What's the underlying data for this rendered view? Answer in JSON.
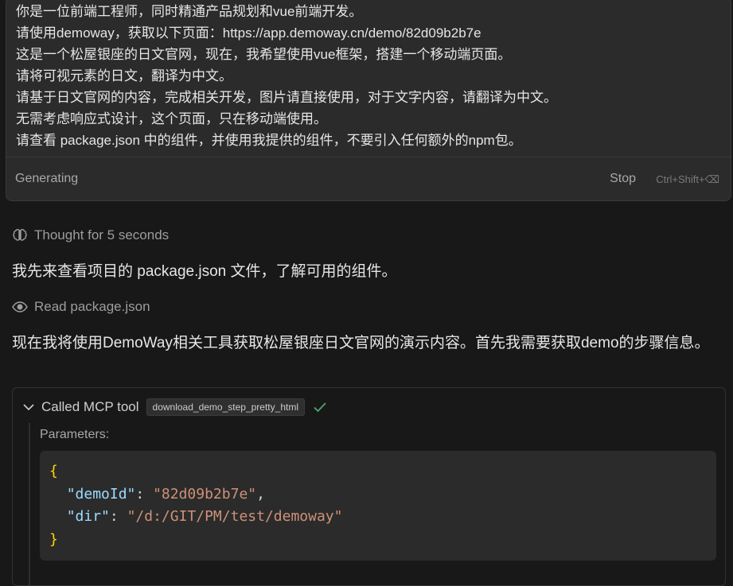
{
  "prompt": {
    "lines": [
      "你是一位前端工程师，同时精通产品规划和vue前端开发。",
      "请使用demoway，获取以下页面：https://app.demoway.cn/demo/82d09b2b7e",
      "这是一个松屋银座的日文官网，现在，我希望使用vue框架，搭建一个移动端页面。",
      "请将可视元素的日文，翻译为中文。",
      "请基于日文官网的内容，完成相关开发，图片请直接使用，对于文字内容，请翻译为中文。",
      "无需考虑响应式设计，这个页面，只在移动端使用。",
      "请查看 package.json 中的组件，并使用我提供的组件，不要引入任何额外的npm包。"
    ],
    "status": "Generating",
    "stop_label": "Stop",
    "stop_shortcut": "Ctrl+Shift+⌫"
  },
  "thought": {
    "icon": "brain-icon",
    "text": "Thought for 5 seconds"
  },
  "messages": {
    "first": "我先来查看项目的 package.json 文件，了解可用的组件。",
    "second": "现在我将使用DemoWay相关工具获取松屋银座日文官网的演示内容。首先我需要获取demo的步骤信息。"
  },
  "read_action": {
    "icon": "eye-icon",
    "text": "Read package.json"
  },
  "tool_call": {
    "title": "Called MCP tool",
    "tool_name": "download_demo_step_pretty_html",
    "status_icon": "check-icon",
    "params_label": "Parameters:",
    "code": {
      "open_brace": "{",
      "k1": "\"demoId\"",
      "v1": "\"82d09b2b7e\"",
      "k2": "\"dir\"",
      "v2": "\"/d:/GIT/PM/test/demoway\"",
      "close_brace": "}"
    }
  },
  "colors": {
    "background": "#181818",
    "panel": "#2b2b2b",
    "check": "#4ea672",
    "json_key": "#9cdcfe",
    "json_string": "#ce9178",
    "json_brace": "#ffd700"
  }
}
